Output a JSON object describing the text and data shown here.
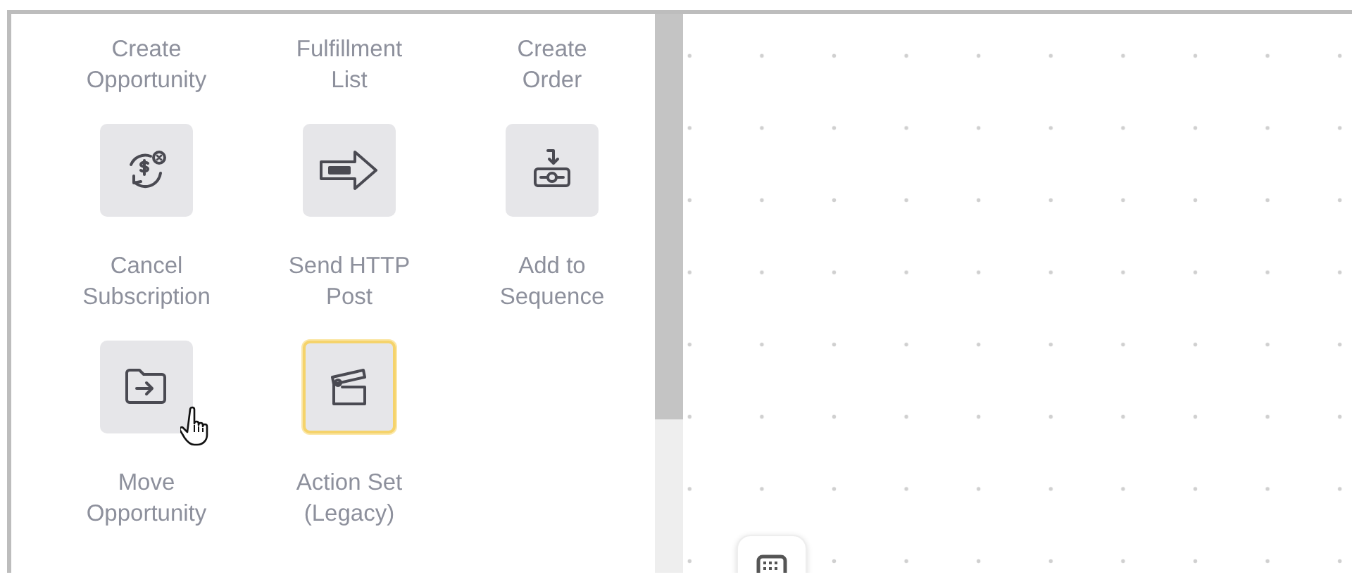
{
  "palette": {
    "items": [
      {
        "kind": "label-only",
        "label": "Create\nOpportunity"
      },
      {
        "kind": "label-only",
        "label": "Fulfillment\nList"
      },
      {
        "kind": "label-only",
        "label": "Create\nOrder"
      },
      {
        "kind": "tile",
        "label": "Cancel\nSubscription",
        "selected": false
      },
      {
        "kind": "tile",
        "label": "Send HTTP\nPost",
        "selected": false
      },
      {
        "kind": "tile",
        "label": "Add to\nSequence",
        "selected": false
      },
      {
        "kind": "tile",
        "label": "Move\nOpportunity",
        "selected": false
      },
      {
        "kind": "tile",
        "label": "Action Set\n(Legacy)",
        "selected": true
      }
    ]
  }
}
